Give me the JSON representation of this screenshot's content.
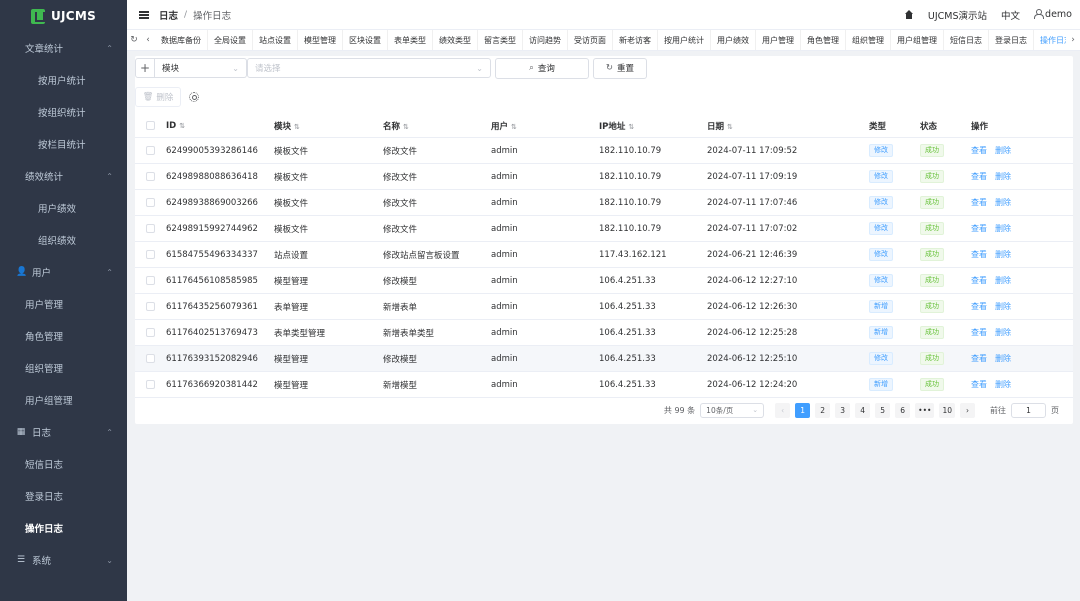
{
  "sidebar": {
    "logo": "UJCMS",
    "menu": [
      {
        "kind": "group",
        "label": "文章统计",
        "icon": "",
        "chev": "⌃"
      },
      {
        "kind": "sub2",
        "label": "按用户统计"
      },
      {
        "kind": "sub2",
        "label": "按组织统计"
      },
      {
        "kind": "sub2",
        "label": "按栏目统计"
      },
      {
        "kind": "group-plain",
        "label": "绩效统计",
        "icon": "",
        "chev": "⌃"
      },
      {
        "kind": "sub2",
        "label": "用户绩效"
      },
      {
        "kind": "sub2",
        "label": "组织绩效"
      },
      {
        "kind": "group",
        "label": "用户",
        "icon": "👤",
        "chev": "⌃"
      },
      {
        "kind": "sub1",
        "label": "用户管理"
      },
      {
        "kind": "sub1",
        "label": "角色管理"
      },
      {
        "kind": "sub1",
        "label": "组织管理"
      },
      {
        "kind": "sub1",
        "label": "用户组管理"
      },
      {
        "kind": "group",
        "label": "日志",
        "icon": "▦",
        "chev": "⌃"
      },
      {
        "kind": "sub1",
        "label": "短信日志"
      },
      {
        "kind": "sub1",
        "label": "登录日志"
      },
      {
        "kind": "sub1-active",
        "label": "操作日志"
      },
      {
        "kind": "group",
        "label": "系统",
        "icon": "☰",
        "chev": "⌄"
      }
    ]
  },
  "header": {
    "breadcrumb_root": "日志",
    "breadcrumb_sep": "/",
    "breadcrumb_current": "操作日志",
    "site": "UJCMS演示站",
    "lang": "中文",
    "user": "demo"
  },
  "tabs": {
    "refresh": "↻",
    "prev": "‹",
    "next": "›",
    "items": [
      "数据库备份",
      "全局设置",
      "站点设置",
      "模型管理",
      "区块设置",
      "表单类型",
      "绩效类型",
      "留言类型",
      "访问趋势",
      "受访页面",
      "新老访客",
      "按用户统计",
      "用户绩效",
      "用户管理",
      "角色管理",
      "组织管理",
      "用户组管理",
      "短信日志",
      "登录日志",
      "操作日志"
    ],
    "close": "×"
  },
  "toolbar": {
    "plus": "+",
    "module_select": "模块",
    "filter_placeholder": "请选择",
    "query": "查询",
    "reset": "重置",
    "delete": "删除"
  },
  "table": {
    "headers": {
      "id": "ID",
      "module": "模块",
      "name": "名称",
      "user": "用户",
      "ip": "IP地址",
      "date": "日期",
      "type": "类型",
      "status": "状态",
      "ops": "操作"
    },
    "rows": [
      {
        "id": "62499005393286146",
        "module": "模板文件",
        "name": "修改文件",
        "user": "admin",
        "ip": "182.110.10.79",
        "date": "2024-07-11 17:09:52",
        "type": "修改",
        "type_kind": "blue",
        "status": "成功",
        "view": "查看",
        "del": "删除"
      },
      {
        "id": "62498988088636418",
        "module": "模板文件",
        "name": "修改文件",
        "user": "admin",
        "ip": "182.110.10.79",
        "date": "2024-07-11 17:09:19",
        "type": "修改",
        "type_kind": "blue",
        "status": "成功",
        "view": "查看",
        "del": "删除"
      },
      {
        "id": "62498938869003266",
        "module": "模板文件",
        "name": "修改文件",
        "user": "admin",
        "ip": "182.110.10.79",
        "date": "2024-07-11 17:07:46",
        "type": "修改",
        "type_kind": "blue",
        "status": "成功",
        "view": "查看",
        "del": "删除"
      },
      {
        "id": "62498915992744962",
        "module": "模板文件",
        "name": "修改文件",
        "user": "admin",
        "ip": "182.110.10.79",
        "date": "2024-07-11 17:07:02",
        "type": "修改",
        "type_kind": "blue",
        "status": "成功",
        "view": "查看",
        "del": "删除"
      },
      {
        "id": "61584755496334337",
        "module": "站点设置",
        "name": "修改站点留言板设置",
        "user": "admin",
        "ip": "117.43.162.121",
        "date": "2024-06-21 12:46:39",
        "type": "修改",
        "type_kind": "blue",
        "status": "成功",
        "view": "查看",
        "del": "删除"
      },
      {
        "id": "61176456108585985",
        "module": "模型管理",
        "name": "修改模型",
        "user": "admin",
        "ip": "106.4.251.33",
        "date": "2024-06-12 12:27:10",
        "type": "修改",
        "type_kind": "blue",
        "status": "成功",
        "view": "查看",
        "del": "删除"
      },
      {
        "id": "61176435256079361",
        "module": "表单管理",
        "name": "新增表单",
        "user": "admin",
        "ip": "106.4.251.33",
        "date": "2024-06-12 12:26:30",
        "type": "新增",
        "type_kind": "blue",
        "status": "成功",
        "view": "查看",
        "del": "删除"
      },
      {
        "id": "61176402513769473",
        "module": "表单类型管理",
        "name": "新增表单类型",
        "user": "admin",
        "ip": "106.4.251.33",
        "date": "2024-06-12 12:25:28",
        "type": "新增",
        "type_kind": "blue",
        "status": "成功",
        "view": "查看",
        "del": "删除"
      },
      {
        "id": "61176393152082946",
        "module": "模型管理",
        "name": "修改模型",
        "user": "admin",
        "ip": "106.4.251.33",
        "date": "2024-06-12 12:25:10",
        "type": "修改",
        "type_kind": "blue",
        "status": "成功",
        "view": "查看",
        "del": "删除"
      },
      {
        "id": "61176366920381442",
        "module": "模型管理",
        "name": "新增模型",
        "user": "admin",
        "ip": "106.4.251.33",
        "date": "2024-06-12 12:24:20",
        "type": "新增",
        "type_kind": "blue",
        "status": "成功",
        "view": "查看",
        "del": "删除"
      }
    ],
    "highlight_row": 8
  },
  "pagination": {
    "total": "共 99 条",
    "page_size": "10条/页",
    "prev": "‹",
    "pages": [
      "1",
      "2",
      "3",
      "4",
      "5",
      "6",
      "•••",
      "10"
    ],
    "current": "1",
    "next": "›",
    "goto_label": "前往",
    "goto_value": "1",
    "goto_suffix": "页"
  },
  "colors": {
    "accent": "#409eff",
    "sidebar_bg": "#2f3747",
    "success": "#67c23a",
    "logo": "#3fb950"
  }
}
